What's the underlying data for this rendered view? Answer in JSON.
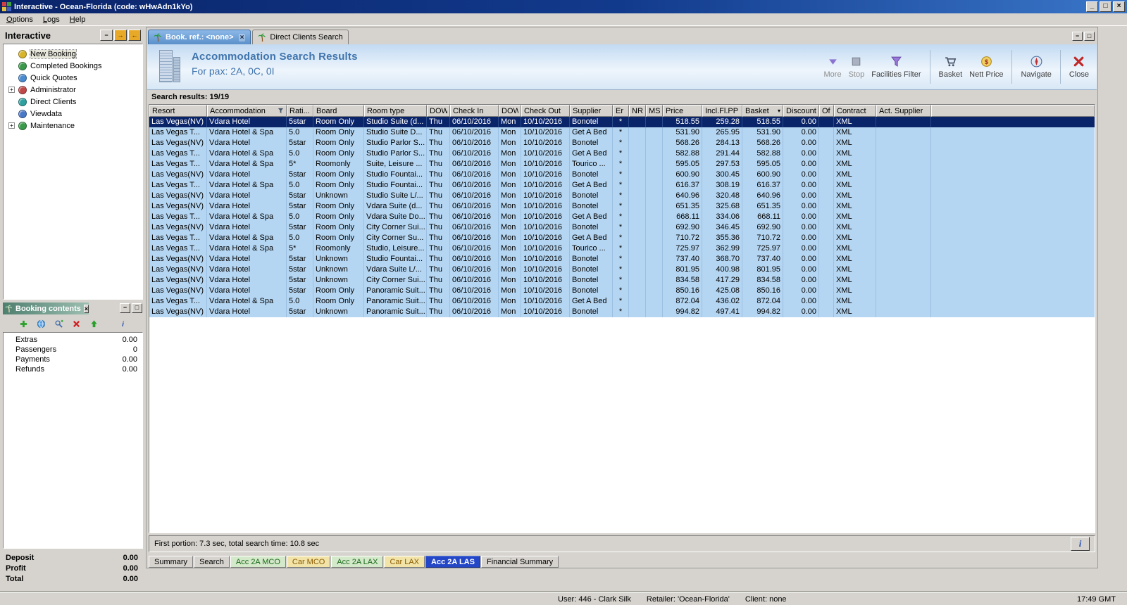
{
  "window": {
    "title": "Interactive - Ocean-Florida (code: wHwAdn1kYo)",
    "menu": [
      "Options",
      "Logs",
      "Help"
    ]
  },
  "sidebar": {
    "title": "Interactive",
    "items": [
      {
        "label": "New Booking",
        "icon": "booking-icon",
        "icon_color": "#d8b428",
        "selected": true
      },
      {
        "label": "Completed Bookings",
        "icon": "globe-icon",
        "icon_color": "#3a9a4a"
      },
      {
        "label": "Quick Quotes",
        "icon": "globe-icon",
        "icon_color": "#4a8ad0"
      },
      {
        "label": "Administrator",
        "icon": "globe-icon",
        "icon_color": "#c04848",
        "expandable": true
      },
      {
        "label": "Direct Clients",
        "icon": "globe-icon",
        "icon_color": "#2fa0a0"
      },
      {
        "label": "Viewdata",
        "icon": "globe-icon",
        "icon_color": "#4a78c8"
      },
      {
        "label": "Maintenance",
        "icon": "globe-icon",
        "icon_color": "#3a9a4a",
        "expandable": true
      }
    ]
  },
  "booking_contents": {
    "title": "Booking contents",
    "toolbar_icons": [
      "add-icon",
      "globe-icon",
      "search-add-icon",
      "delete-icon",
      "upload-icon",
      "info-icon"
    ],
    "rows": [
      {
        "label": "Extras",
        "value": "0.00"
      },
      {
        "label": "Passengers",
        "value": "0"
      },
      {
        "label": "Payments",
        "value": "0.00"
      },
      {
        "label": "Refunds",
        "value": "0.00"
      }
    ],
    "totals": [
      {
        "label": "Deposit",
        "value": "0.00"
      },
      {
        "label": "Profit",
        "value": "0.00"
      },
      {
        "label": "Total",
        "value": "0.00"
      }
    ]
  },
  "main": {
    "tabs": [
      {
        "label": "Book. ref.: <none>",
        "active": true,
        "closable": true
      },
      {
        "label": "Direct Clients Search",
        "active": false
      }
    ],
    "header": {
      "title": "Accommodation Search Results",
      "subtitle": "For pax: 2A, 0C, 0I"
    },
    "toolbar_groups": [
      [
        {
          "label": "More",
          "icon": "more-icon",
          "enabled": false
        },
        {
          "label": "Stop",
          "icon": "stop-icon",
          "enabled": false
        },
        {
          "label": "Facilities Filter",
          "icon": "filter-icon",
          "enabled": true
        }
      ],
      [
        {
          "label": "Basket",
          "icon": "basket-icon",
          "enabled": true
        },
        {
          "label": "Nett Price",
          "icon": "nett-price-icon",
          "enabled": true
        }
      ],
      [
        {
          "label": "Navigate",
          "icon": "navigate-icon",
          "enabled": true
        }
      ],
      [
        {
          "label": "Close",
          "icon": "close-icon",
          "enabled": true
        }
      ]
    ],
    "results_label": "Search results: 19/19",
    "status_text": "First portion: 7.3 sec, total search time: 10.8 sec",
    "bottom_tabs": [
      {
        "label": "Summary",
        "text_color": "#000000",
        "bg": "#d6d3ce"
      },
      {
        "label": "Search",
        "text_color": "#000000",
        "bg": "#d6d3ce"
      },
      {
        "label": "Acc 2A MCO",
        "text_color": "#1a6a1a",
        "bg": "#d4e8ca"
      },
      {
        "label": "Car MCO",
        "text_color": "#8a5a00",
        "bg": "#f2e4a8"
      },
      {
        "label": "Acc 2A LAX",
        "text_color": "#1a6a1a",
        "bg": "#d4e8ca"
      },
      {
        "label": "Car LAX",
        "text_color": "#8a5a00",
        "bg": "#f2e4a8"
      },
      {
        "label": "Acc 2A LAS",
        "text_color": "#ffffff",
        "bg": "#2447c8",
        "selected": true
      },
      {
        "label": "Financial Summary",
        "text_color": "#000000",
        "bg": "#d6d3ce"
      }
    ]
  },
  "table": {
    "selected_row": 0,
    "filter_column": 1,
    "sort_column": 15,
    "columns": [
      "Resort",
      "Accommodation",
      "Rati...",
      "Board",
      "Room type",
      "DOW",
      "Check In",
      "DOW",
      "Check Out",
      "Supplier",
      "Er",
      "NR",
      "MS",
      "Price",
      "Incl.Fl.PP",
      "Basket",
      "Discount",
      "Of",
      "Contract",
      "Act. Supplier"
    ],
    "rows": [
      [
        "Las Vegas(NV)",
        "Vdara Hotel",
        "5star",
        "Room Only",
        "Studio Suite (d...",
        "Thu",
        "06/10/2016",
        "Mon",
        "10/10/2016",
        "Bonotel",
        "*",
        "",
        "",
        "518.55",
        "259.28",
        "518.55",
        "0.00",
        "",
        "XML",
        ""
      ],
      [
        "Las Vegas T...",
        "Vdara Hotel & Spa",
        "5.0",
        "Room Only",
        "Studio Suite D...",
        "Thu",
        "06/10/2016",
        "Mon",
        "10/10/2016",
        "Get A Bed",
        "*",
        "",
        "",
        "531.90",
        "265.95",
        "531.90",
        "0.00",
        "",
        "XML",
        ""
      ],
      [
        "Las Vegas(NV)",
        "Vdara Hotel",
        "5star",
        "Room Only",
        "Studio Parlor S...",
        "Thu",
        "06/10/2016",
        "Mon",
        "10/10/2016",
        "Bonotel",
        "*",
        "",
        "",
        "568.26",
        "284.13",
        "568.26",
        "0.00",
        "",
        "XML",
        ""
      ],
      [
        "Las Vegas T...",
        "Vdara Hotel & Spa",
        "5.0",
        "Room Only",
        "Studio Parlor S...",
        "Thu",
        "06/10/2016",
        "Mon",
        "10/10/2016",
        "Get A Bed",
        "*",
        "",
        "",
        "582.88",
        "291.44",
        "582.88",
        "0.00",
        "",
        "XML",
        ""
      ],
      [
        "Las Vegas T...",
        "Vdara Hotel & Spa",
        "5*",
        "Roomonly",
        "Suite, Leisure ...",
        "Thu",
        "06/10/2016",
        "Mon",
        "10/10/2016",
        "Tourico ...",
        "*",
        "",
        "",
        "595.05",
        "297.53",
        "595.05",
        "0.00",
        "",
        "XML",
        ""
      ],
      [
        "Las Vegas(NV)",
        "Vdara Hotel",
        "5star",
        "Room Only",
        "Studio Fountai...",
        "Thu",
        "06/10/2016",
        "Mon",
        "10/10/2016",
        "Bonotel",
        "*",
        "",
        "",
        "600.90",
        "300.45",
        "600.90",
        "0.00",
        "",
        "XML",
        ""
      ],
      [
        "Las Vegas T...",
        "Vdara Hotel & Spa",
        "5.0",
        "Room Only",
        "Studio Fountai...",
        "Thu",
        "06/10/2016",
        "Mon",
        "10/10/2016",
        "Get A Bed",
        "*",
        "",
        "",
        "616.37",
        "308.19",
        "616.37",
        "0.00",
        "",
        "XML",
        ""
      ],
      [
        "Las Vegas(NV)",
        "Vdara Hotel",
        "5star",
        "Unknown",
        "Studio Suite L/...",
        "Thu",
        "06/10/2016",
        "Mon",
        "10/10/2016",
        "Bonotel",
        "*",
        "",
        "",
        "640.96",
        "320.48",
        "640.96",
        "0.00",
        "",
        "XML",
        ""
      ],
      [
        "Las Vegas(NV)",
        "Vdara Hotel",
        "5star",
        "Room Only",
        "Vdara Suite (d...",
        "Thu",
        "06/10/2016",
        "Mon",
        "10/10/2016",
        "Bonotel",
        "*",
        "",
        "",
        "651.35",
        "325.68",
        "651.35",
        "0.00",
        "",
        "XML",
        ""
      ],
      [
        "Las Vegas T...",
        "Vdara Hotel & Spa",
        "5.0",
        "Room Only",
        "Vdara Suite Do...",
        "Thu",
        "06/10/2016",
        "Mon",
        "10/10/2016",
        "Get A Bed",
        "*",
        "",
        "",
        "668.11",
        "334.06",
        "668.11",
        "0.00",
        "",
        "XML",
        ""
      ],
      [
        "Las Vegas(NV)",
        "Vdara Hotel",
        "5star",
        "Room Only",
        "City Corner Sui...",
        "Thu",
        "06/10/2016",
        "Mon",
        "10/10/2016",
        "Bonotel",
        "*",
        "",
        "",
        "692.90",
        "346.45",
        "692.90",
        "0.00",
        "",
        "XML",
        ""
      ],
      [
        "Las Vegas T...",
        "Vdara Hotel & Spa",
        "5.0",
        "Room Only",
        "City Corner Su...",
        "Thu",
        "06/10/2016",
        "Mon",
        "10/10/2016",
        "Get A Bed",
        "*",
        "",
        "",
        "710.72",
        "355.36",
        "710.72",
        "0.00",
        "",
        "XML",
        ""
      ],
      [
        "Las Vegas T...",
        "Vdara Hotel & Spa",
        "5*",
        "Roomonly",
        "Studio, Leisure...",
        "Thu",
        "06/10/2016",
        "Mon",
        "10/10/2016",
        "Tourico ...",
        "*",
        "",
        "",
        "725.97",
        "362.99",
        "725.97",
        "0.00",
        "",
        "XML",
        ""
      ],
      [
        "Las Vegas(NV)",
        "Vdara Hotel",
        "5star",
        "Unknown",
        "Studio Fountai...",
        "Thu",
        "06/10/2016",
        "Mon",
        "10/10/2016",
        "Bonotel",
        "*",
        "",
        "",
        "737.40",
        "368.70",
        "737.40",
        "0.00",
        "",
        "XML",
        ""
      ],
      [
        "Las Vegas(NV)",
        "Vdara Hotel",
        "5star",
        "Unknown",
        "Vdara Suite L/...",
        "Thu",
        "06/10/2016",
        "Mon",
        "10/10/2016",
        "Bonotel",
        "*",
        "",
        "",
        "801.95",
        "400.98",
        "801.95",
        "0.00",
        "",
        "XML",
        ""
      ],
      [
        "Las Vegas(NV)",
        "Vdara Hotel",
        "5star",
        "Unknown",
        "City Corner Sui...",
        "Thu",
        "06/10/2016",
        "Mon",
        "10/10/2016",
        "Bonotel",
        "*",
        "",
        "",
        "834.58",
        "417.29",
        "834.58",
        "0.00",
        "",
        "XML",
        ""
      ],
      [
        "Las Vegas(NV)",
        "Vdara Hotel",
        "5star",
        "Room Only",
        "Panoramic Suit...",
        "Thu",
        "06/10/2016",
        "Mon",
        "10/10/2016",
        "Bonotel",
        "*",
        "",
        "",
        "850.16",
        "425.08",
        "850.16",
        "0.00",
        "",
        "XML",
        ""
      ],
      [
        "Las Vegas T...",
        "Vdara Hotel & Spa",
        "5.0",
        "Room Only",
        "Panoramic Suit...",
        "Thu",
        "06/10/2016",
        "Mon",
        "10/10/2016",
        "Get A Bed",
        "*",
        "",
        "",
        "872.04",
        "436.02",
        "872.04",
        "0.00",
        "",
        "XML",
        ""
      ],
      [
        "Las Vegas(NV)",
        "Vdara Hotel",
        "5star",
        "Unknown",
        "Panoramic Suit...",
        "Thu",
        "06/10/2016",
        "Mon",
        "10/10/2016",
        "Bonotel",
        "*",
        "",
        "",
        "994.82",
        "497.41",
        "994.82",
        "0.00",
        "",
        "XML",
        ""
      ]
    ]
  },
  "statusbar": {
    "user": "User: 446 - Clark Silk",
    "retailer": "Retailer: 'Ocean-Florida'",
    "client": "Client: none",
    "time": "17:49 GMT"
  }
}
